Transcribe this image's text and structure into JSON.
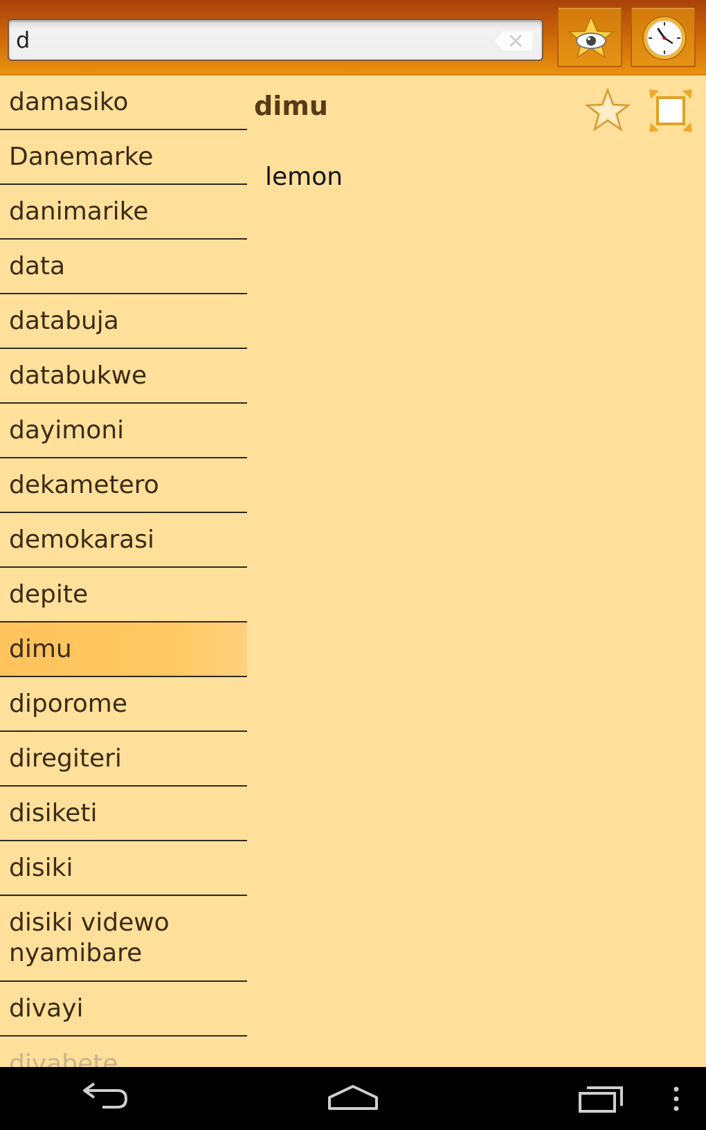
{
  "search": {
    "value": "d",
    "placeholder": ""
  },
  "toolbar": {
    "favorites_icon": "star-eye-icon",
    "history_icon": "clock-icon"
  },
  "word_list": [
    "damasiko",
    "Danemarke",
    "danimarike",
    "data",
    "databuja",
    "databukwe",
    "dayimoni",
    "dekametero",
    "demokarasi",
    "depite",
    "dimu",
    "diporome",
    "diregiteri",
    "disiketi",
    "disiki",
    "disiki videwo nyamibare",
    "divayi",
    "diyabete"
  ],
  "selected_word": "dimu",
  "detail": {
    "word": "dimu",
    "translation": "lemon"
  },
  "colors": {
    "accent": "#E9920E",
    "background": "#FFE09A",
    "selected": "#FFC35C"
  }
}
